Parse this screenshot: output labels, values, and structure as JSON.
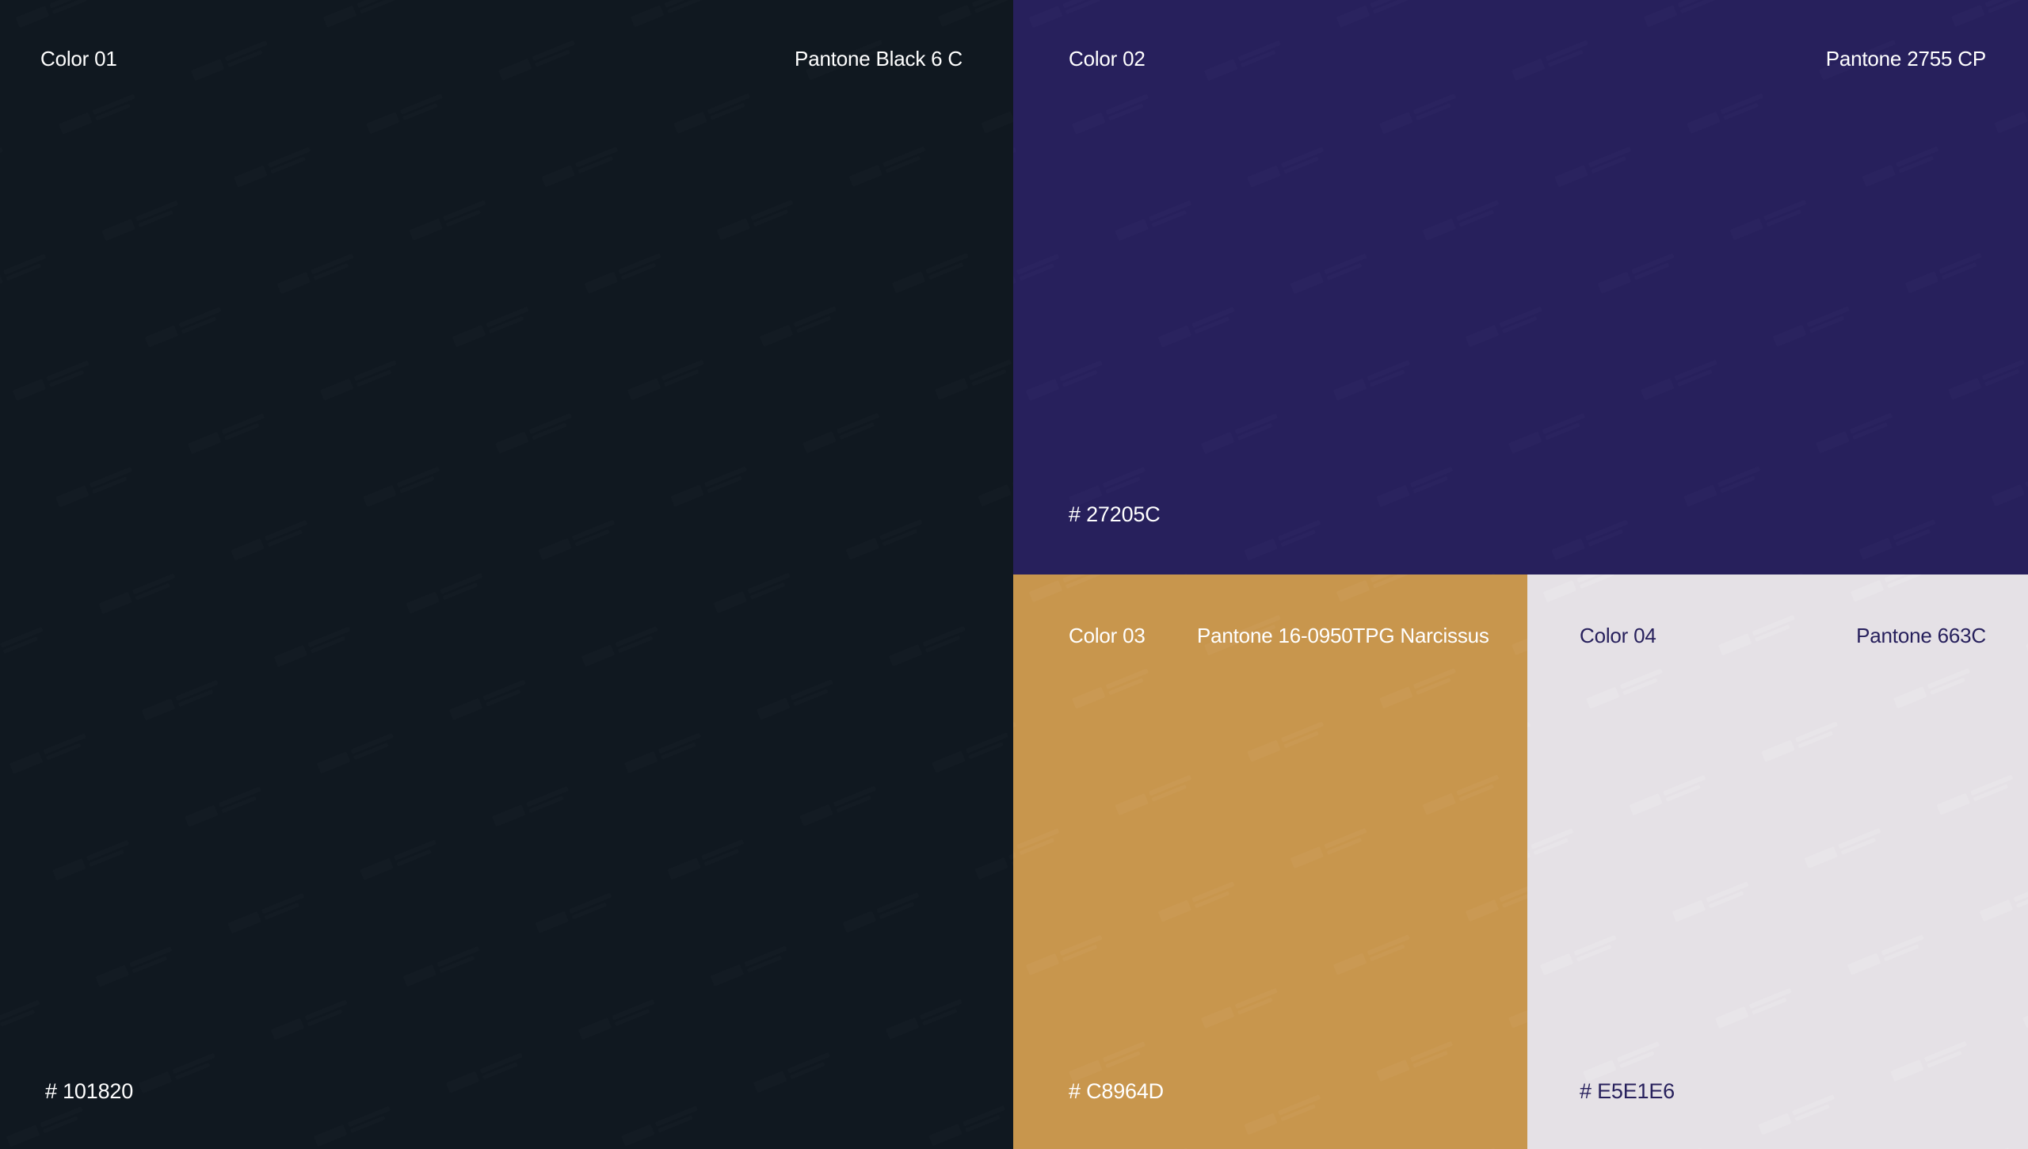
{
  "colors": [
    {
      "name": "Color 01",
      "pantone": "Pantone Black 6 C",
      "hex": "# 101820",
      "background": "#101820",
      "text_color": "#FFFFFF"
    },
    {
      "name": "Color 02",
      "pantone": "Pantone 2755 CP",
      "hex": "# 27205C",
      "background": "#27205C",
      "text_color": "#FFFFFF"
    },
    {
      "name": "Color 03",
      "pantone": "Pantone 16-0950TPG Narcissus",
      "hex": "# C8964D",
      "background": "#C8964D",
      "text_color": "#FFFFFF"
    },
    {
      "name": "Color 04",
      "pantone": "Pantone 663C",
      "hex": "# E5E1E6",
      "background": "#E5E1E6",
      "text_color": "#27205C"
    }
  ]
}
